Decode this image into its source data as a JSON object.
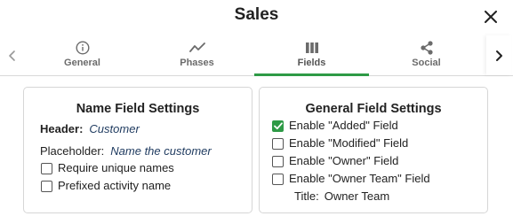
{
  "title": "Sales",
  "tabs": [
    {
      "label": "General",
      "icon": "info-icon"
    },
    {
      "label": "Phases",
      "icon": "trend-icon"
    },
    {
      "label": "Fields",
      "icon": "columns-icon"
    },
    {
      "label": "Social",
      "icon": "share-icon"
    }
  ],
  "active_tab": "Fields",
  "accent_color": "#2e9a46",
  "name_field_settings": {
    "heading": "Name Field Settings",
    "header_label": "Header:",
    "header_value": "Customer",
    "placeholder_label": "Placeholder:",
    "placeholder_value": "Name the customer",
    "options": [
      {
        "label": "Require unique names",
        "checked": false
      },
      {
        "label": "Prefixed activity name",
        "checked": false
      }
    ]
  },
  "general_field_settings": {
    "heading": "General Field Settings",
    "options": [
      {
        "label": "Enable \"Added\" Field",
        "checked": true
      },
      {
        "label": "Enable \"Modified\" Field",
        "checked": false
      },
      {
        "label": "Enable \"Owner\" Field",
        "checked": false
      },
      {
        "label": "Enable \"Owner Team\" Field",
        "checked": false
      }
    ],
    "title_label": "Title:",
    "title_value": "Owner Team"
  }
}
